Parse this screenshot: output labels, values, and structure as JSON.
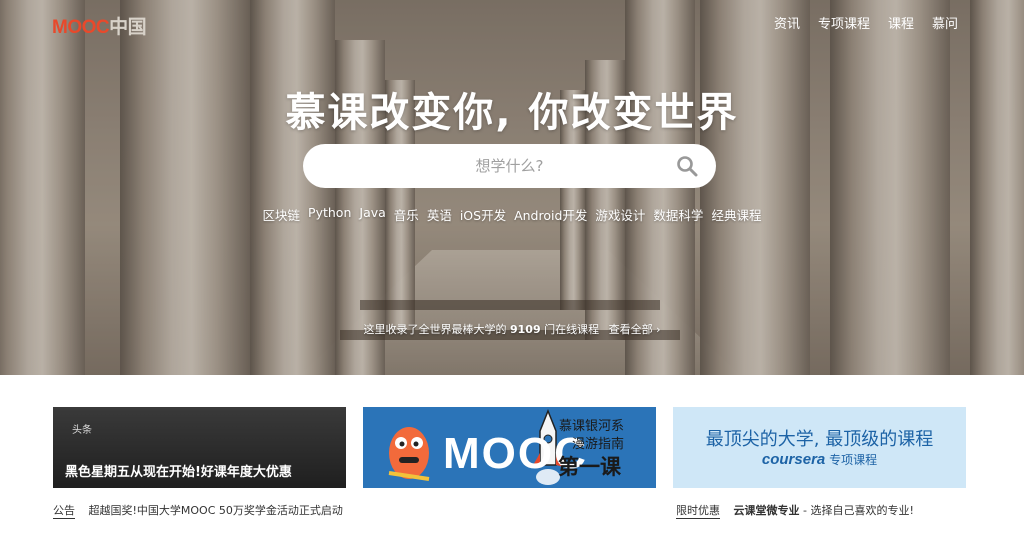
{
  "logo": {
    "mooc": "MOOC",
    "china": "中国"
  },
  "nav": [
    "资讯",
    "专项课程",
    "课程",
    "慕问"
  ],
  "headline": "慕课改变你, 你改变世界",
  "search": {
    "placeholder": "想学什么?"
  },
  "tags": [
    "区块链",
    "Python",
    "Java",
    "音乐",
    "英语",
    "iOS开发",
    "Android开发",
    "游戏设计",
    "数据科学",
    "经典课程"
  ],
  "count": {
    "prefix": "这里收录了全世界最棒大学的",
    "number": "9109",
    "suffix": "门在线课程",
    "view_all": "查看全部 ›"
  },
  "cards": {
    "card1": {
      "badge": "头条",
      "title": "黑色星期五从现在开始!好课年度大优惠"
    },
    "card2": {
      "big": "MOOC",
      "sub1": "慕课银河系",
      "sub2": "漫游指南",
      "sub3": "第一课"
    },
    "card3": {
      "line1": "最顶尖的大学, 最顶级的课程",
      "brand": "coursera",
      "line2_suffix": "专项课程"
    }
  },
  "news": {
    "left": {
      "label": "公告",
      "text": "超越国奖!中国大学MOOC 50万奖学金活动正式启动"
    },
    "right": {
      "label": "限时优惠",
      "bold": "云课堂微专业",
      "text": " - 选择自己喜欢的专业!"
    }
  },
  "colors": {
    "logo_red": "#e8492b",
    "card2_bg": "#2b74b8",
    "card3_bg": "#cfe7f7",
    "card3_text": "#1d63a6"
  }
}
